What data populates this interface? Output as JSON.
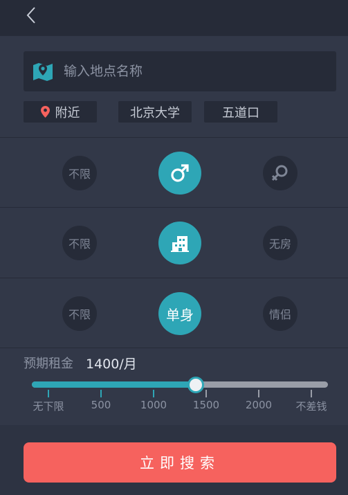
{
  "search": {
    "placeholder": "输入地点名称",
    "icon": "map-icon"
  },
  "location_chips": [
    {
      "label": "附近",
      "icon": "location-pin-icon"
    },
    {
      "label": "北京大学"
    },
    {
      "label": "五道口"
    }
  ],
  "filters": {
    "gender": {
      "options": [
        "不限",
        "male",
        "female"
      ],
      "selected": "male"
    },
    "housing": {
      "options": [
        "不限",
        "has-room",
        "无房"
      ],
      "selected": "has-room"
    },
    "status": {
      "options": [
        "不限",
        "单身",
        "情侣"
      ],
      "selected": "单身"
    }
  },
  "rent": {
    "label": "预期租金",
    "value_text": "1400/月",
    "value": 1400,
    "ticks": [
      "无下限",
      "500",
      "1000",
      "1500",
      "2000",
      "不差钱"
    ]
  },
  "submit": {
    "label": "立即搜索"
  },
  "colors": {
    "background": "#2d3342",
    "panel": "#323848",
    "dark_field": "#262b38",
    "accent": "#2ea6b6",
    "button": "#f6625e",
    "pin": "#f6625e"
  }
}
